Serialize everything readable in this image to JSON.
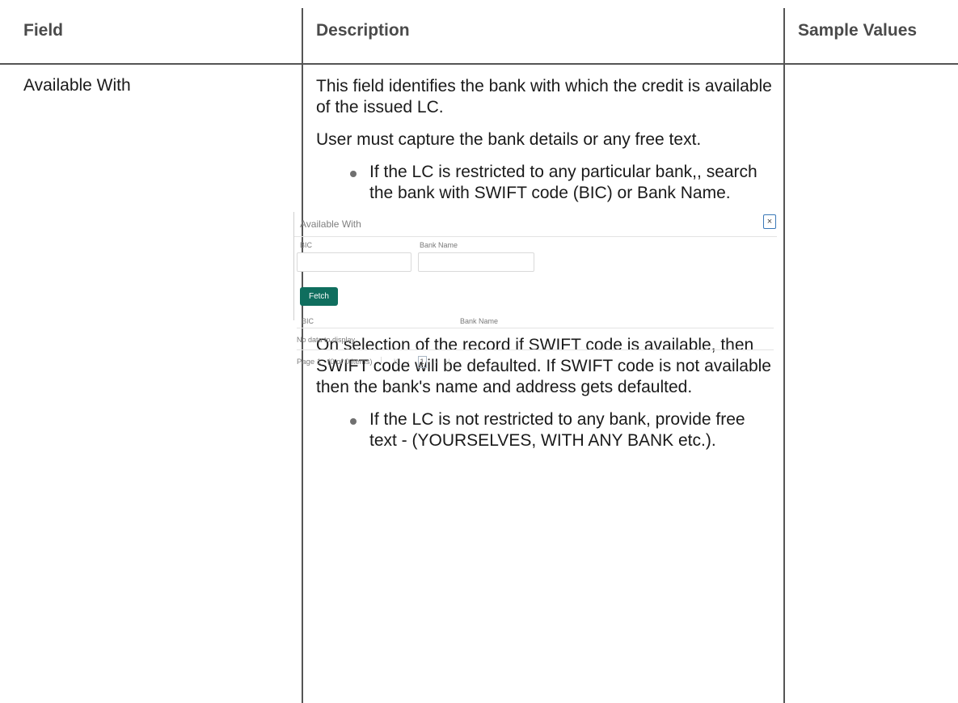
{
  "table": {
    "headers": {
      "field": "Field",
      "description": "Description",
      "sample_values": "Sample Values"
    },
    "row": {
      "field": "Available With",
      "para1": "This field identifies the bank with which the credit is available of the issued LC.",
      "para2": "User must capture the bank details or any free text.",
      "bullet1": "If the LC is restricted to any particular bank,, search the bank with SWIFT code (BIC) or Bank Name.",
      "para3": "On selection of the record if SWIFT code is available, then SWIFT code will be defaulted. If SWIFT code is not available then the bank's name and address gets defaulted.",
      "bullet2": "If the LC is not restricted to any bank, provide free text - (YOURSELVES, WITH ANY BANK etc.)."
    }
  },
  "dialog": {
    "title": "Available With",
    "close_glyph": "×",
    "bic_label": "BIC",
    "bank_name_label": "Bank Name",
    "bic_value": "",
    "bank_name_value": "",
    "fetch_label": "Fetch",
    "columns": [
      "BIC",
      "Bank Name"
    ],
    "empty_text": "No data to display.",
    "pager": {
      "page_label": "Page",
      "page_number": "1",
      "items_text": "(0 of 0 items)",
      "first": "K",
      "prev": "‹",
      "current": "1",
      "next": "›",
      "last": "›|"
    }
  },
  "colors": {
    "fetch_button": "#0f6e5e",
    "close_border": "#3a78b8",
    "grid_lines": "#555555"
  }
}
